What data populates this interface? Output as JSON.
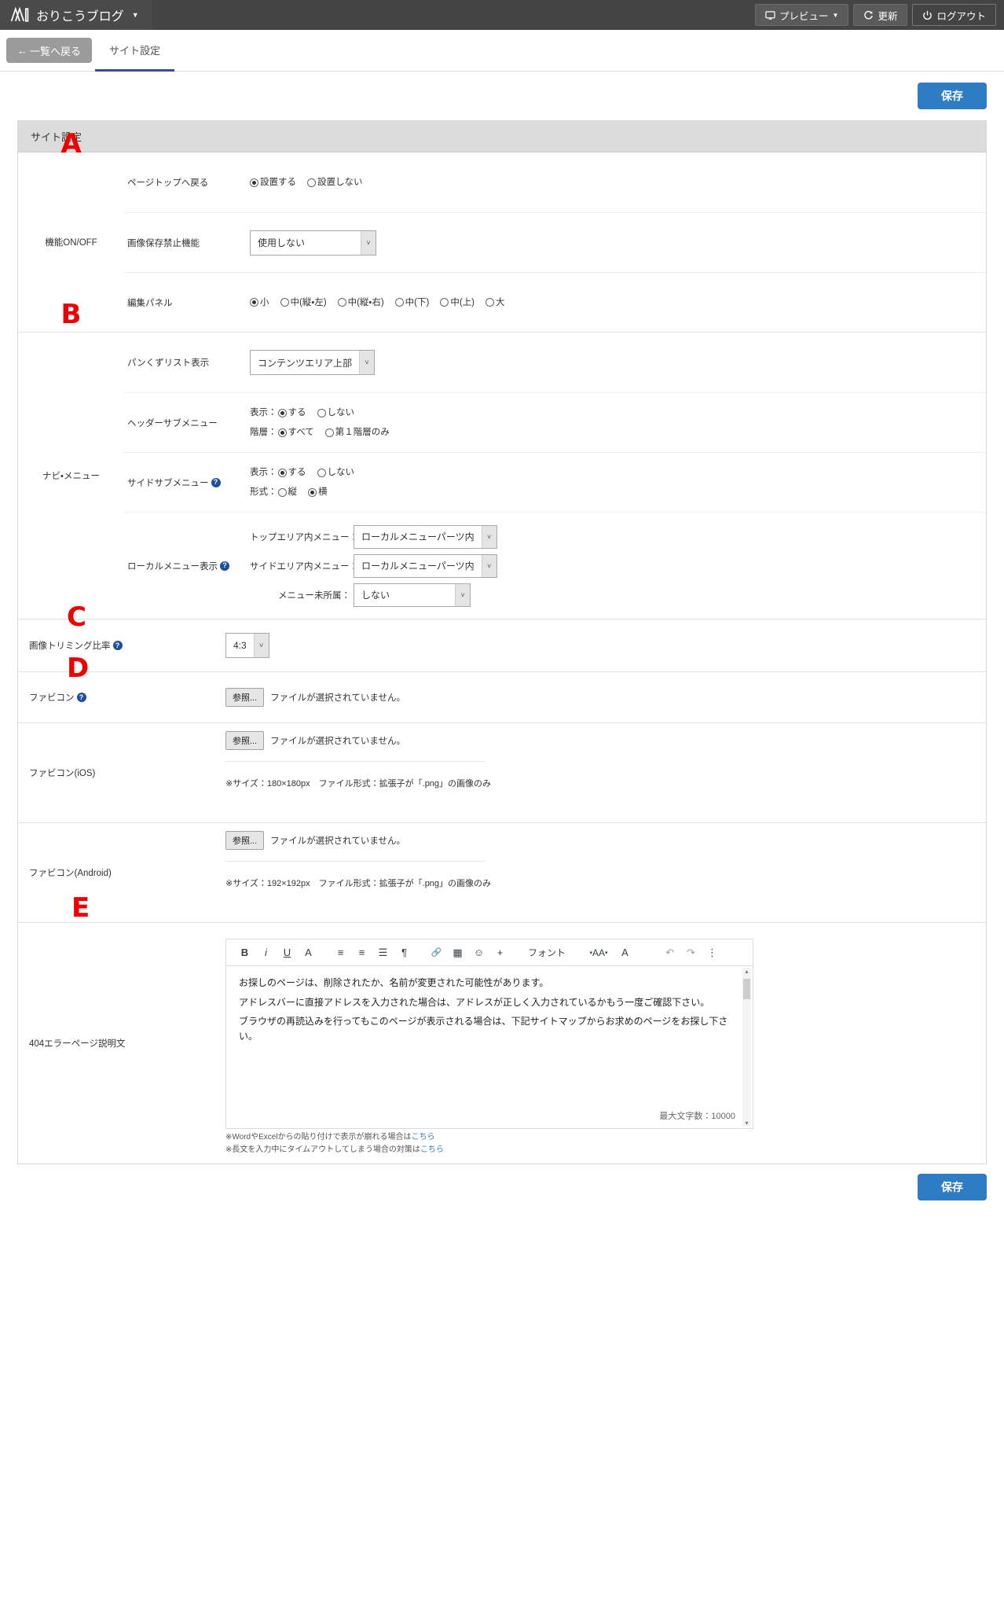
{
  "topbar": {
    "brand": "おりこうブログ",
    "brand_caret": "▼",
    "preview_label": "プレビュー",
    "preview_caret": "▼",
    "update_label": "更新",
    "logout_label": "ログアウト"
  },
  "tabs": {
    "back_label": "一覧へ戻る",
    "back_arrow": "←",
    "site_settings_tab": "サイト設定"
  },
  "actions": {
    "save_top": "保存",
    "save_bottom": "保存"
  },
  "panel": {
    "title": "サイト設定"
  },
  "markers": {
    "a": "A",
    "b": "B",
    "c": "C",
    "d": "D",
    "e": "E"
  },
  "groups": {
    "features": {
      "label": "機能ON/OFF",
      "page_top": {
        "label": "ページトップへ戻る",
        "options": [
          {
            "text": "設置する",
            "selected": true
          },
          {
            "text": "設置しない",
            "selected": false
          }
        ]
      },
      "image_protect": {
        "label": "画像保存禁止機能",
        "value": "使用しない"
      },
      "edit_panel": {
        "label": "編集パネル",
        "options": [
          {
            "text": "小",
            "selected": true
          },
          {
            "text": "中(縦・左)",
            "selected": false
          },
          {
            "text": "中(縦・右)",
            "selected": false
          },
          {
            "text": "中(下)",
            "selected": false
          },
          {
            "text": "中(上)",
            "selected": false
          },
          {
            "text": "大",
            "selected": false
          }
        ]
      }
    },
    "nav": {
      "label": "ナビ・メニュー",
      "breadcrumb": {
        "label": "パンくずリスト表示",
        "value": "コンテンツエリア上部"
      },
      "header_submenu": {
        "label": "ヘッダーサブメニュー",
        "display_prefix": "表示：",
        "display_options": [
          {
            "text": "する",
            "selected": true
          },
          {
            "text": "しない",
            "selected": false
          }
        ],
        "level_prefix": "階層：",
        "level_options": [
          {
            "text": "すべて",
            "selected": true
          },
          {
            "text": "第１階層のみ",
            "selected": false
          }
        ]
      },
      "side_submenu": {
        "label": "サイドサブメニュー",
        "help": "?",
        "display_prefix": "表示：",
        "display_options": [
          {
            "text": "する",
            "selected": true
          },
          {
            "text": "しない",
            "selected": false
          }
        ],
        "format_prefix": "形式：",
        "format_options": [
          {
            "text": "縦",
            "selected": false
          },
          {
            "text": "横",
            "selected": true
          }
        ]
      },
      "local_menu": {
        "label": "ローカルメニュー表示",
        "help": "?",
        "top_area_label": "トップエリア内メニュー：",
        "top_area_value": "ローカルメニューパーツ内",
        "side_area_label": "サイドエリア内メニュー：",
        "side_area_value": "ローカルメニューパーツ内",
        "unassigned_label": "メニュー未所属：",
        "unassigned_value": "しない"
      }
    },
    "trim": {
      "label": "画像トリミング比率",
      "help": "?",
      "value": "4:3"
    },
    "favicon": {
      "label": "ファビコン",
      "help": "?",
      "browse_label": "参照...",
      "no_file_text": "ファイルが選択されていません。"
    },
    "favicon_ios": {
      "label": "ファビコン(iOS)",
      "browse_label": "参照...",
      "no_file_text": "ファイルが選択されていません。",
      "note": "※サイズ：180×180px　ファイル形式：拡張子が「.png」の画像のみ"
    },
    "favicon_android": {
      "label": "ファビコン(Android)",
      "browse_label": "参照...",
      "no_file_text": "ファイルが選択されていません。",
      "note": "※サイズ：192×192px　ファイル形式：拡張子が「.png」の画像のみ"
    },
    "error_page": {
      "label": "404エラーページ説明文",
      "toolbar": {
        "bold": "B",
        "italic": "i",
        "underline": "U",
        "text_color": "A",
        "align": "≡",
        "align_center": "≡",
        "list": "☰",
        "paragraph": "¶",
        "link": "🔗",
        "table": "▦",
        "emoji": "☺",
        "insert": "+",
        "font_label": "フォント",
        "font_size": "AA",
        "clear_format": "A",
        "undo": "↶",
        "redo": "↷",
        "more": "⋮"
      },
      "content": [
        "お探しのページは、削除されたか、名前が変更された可能性があります。",
        "アドレスバーに直接アドレスを入力された場合は、アドレスが正しく入力されているかもう一度ご確認下さい。",
        "ブラウザの再読込みを行ってもこのページが表示される場合は、下記サイトマップからお求めのページをお探し下さい。"
      ],
      "max_chars": "最大文字数：10000",
      "note1_prefix": "※WordやExcelからの貼り付けで表示が崩れる場合は",
      "note1_link": "こちら",
      "note2_prefix": "※長文を入力中にタイムアウトしてしまう場合の対策は",
      "note2_link": "こちら"
    }
  }
}
